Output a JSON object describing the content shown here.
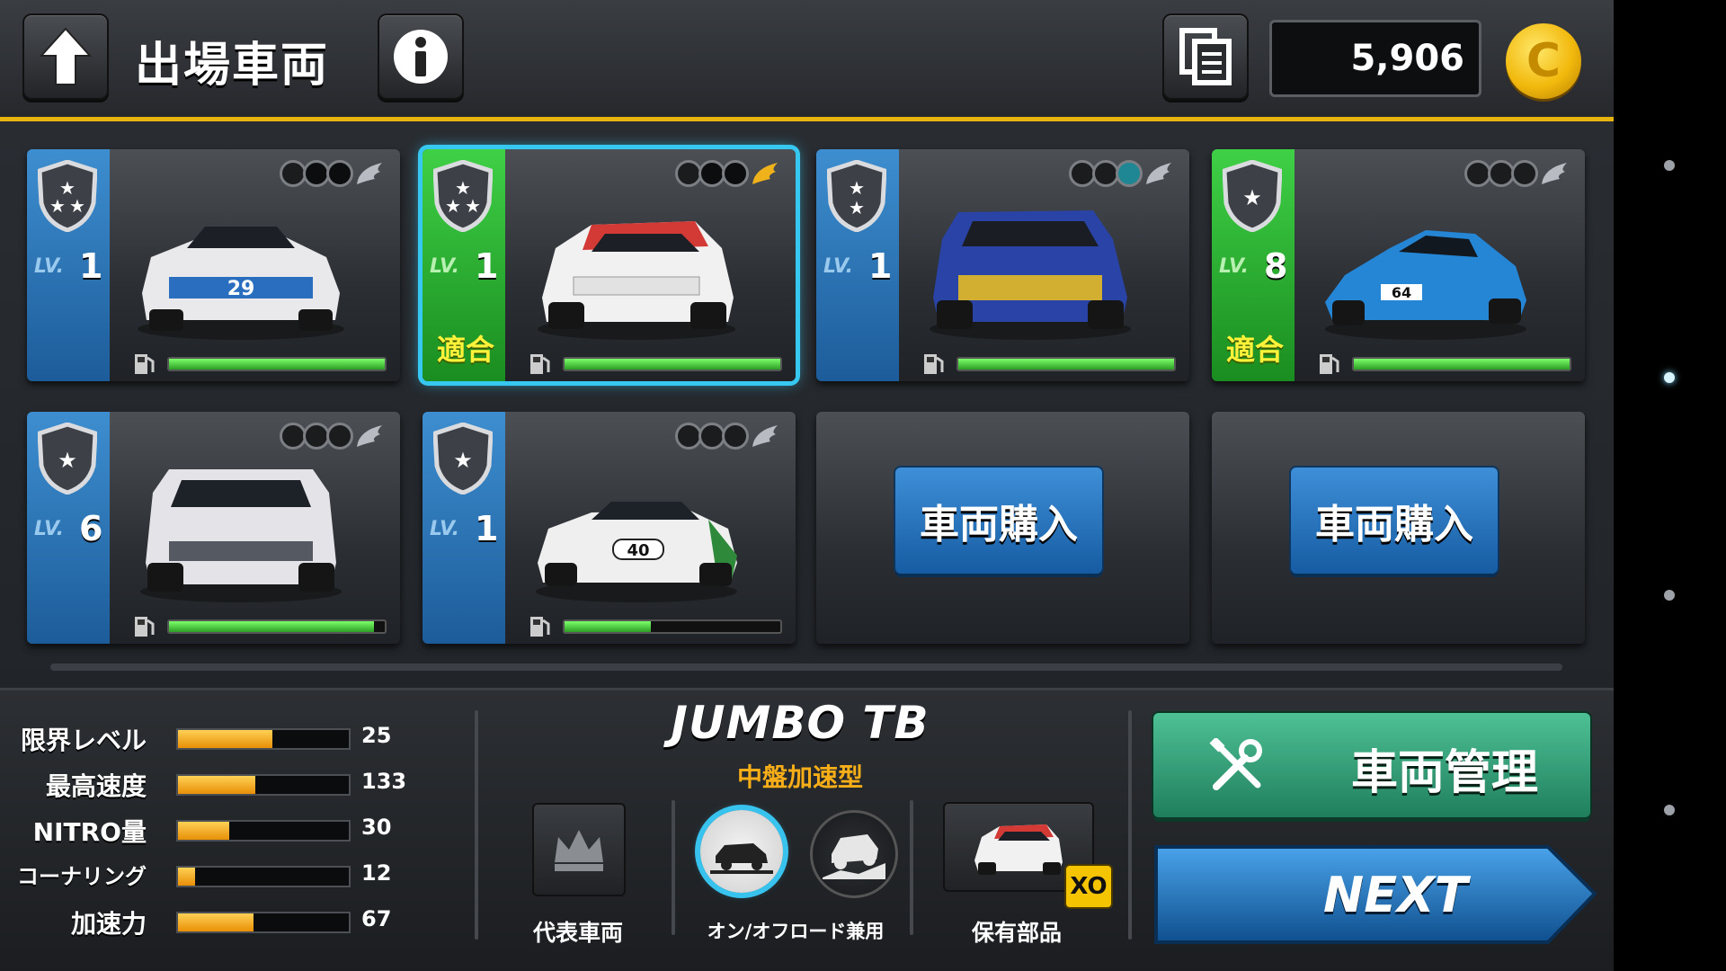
{
  "header": {
    "back_icon": "up-arrow-icon",
    "title": "出場車両",
    "info_icon": "info-icon",
    "list_icon": "list-icon",
    "coins": "5,906",
    "coin_icon": "coin-icon"
  },
  "vehicles": [
    {
      "lv_label": "LV.",
      "level": "1",
      "stars": 3,
      "fit": "",
      "number": "29",
      "fuel": 1.0,
      "upgrade_dots": 2
    },
    {
      "lv_label": "LV.",
      "level": "1",
      "stars": 3,
      "fit": "適合",
      "number": "",
      "fuel": 1.0,
      "upgrade_dots": 2,
      "selected": true
    },
    {
      "lv_label": "LV.",
      "level": "1",
      "stars": 2,
      "fit": "",
      "number": "",
      "fuel": 1.0,
      "upgrade_dots": 1
    },
    {
      "lv_label": "LV.",
      "level": "8",
      "stars": 1,
      "fit": "適合",
      "number": "64",
      "fuel": 1.0,
      "upgrade_dots": 0
    },
    {
      "lv_label": "LV.",
      "level": "6",
      "stars": 1,
      "fit": "",
      "number": "",
      "fuel": 0.95,
      "upgrade_dots": 0
    },
    {
      "lv_label": "LV.",
      "level": "1",
      "stars": 1,
      "fit": "",
      "number": "40",
      "fuel": 0.4,
      "upgrade_dots": 0
    }
  ],
  "buy_slots": [
    {
      "label": "車両購入"
    },
    {
      "label": "車両購入"
    }
  ],
  "stats": [
    {
      "label": "限界レベル",
      "value": "25",
      "fill": 0.55
    },
    {
      "label": "最高速度",
      "value": "133",
      "fill": 0.45
    },
    {
      "label": "NITRO量",
      "value": "30",
      "fill": 0.3
    },
    {
      "label": "コーナリング",
      "value": "12",
      "fill": 0.1
    },
    {
      "label": "加速力",
      "value": "67",
      "fill": 0.44
    }
  ],
  "car_info": {
    "name": "JUMBO TB",
    "type": "中盤加速型",
    "rep_label": "代表車両",
    "terrain_label": "オン/オフロード兼用",
    "parts_label": "保有部品",
    "parts_badge": "XO"
  },
  "actions": {
    "manage_label": "車両管理",
    "next_label": "NEXT"
  },
  "colors": {
    "accent_gold": "#e8b510",
    "selected_border": "#36c8f0",
    "level_blue": "#2a74b8",
    "level_green": "#2fb535",
    "manage_green": "#2f9a72",
    "next_blue": "#1f6fb8",
    "stat_orange": "#f2a012"
  }
}
